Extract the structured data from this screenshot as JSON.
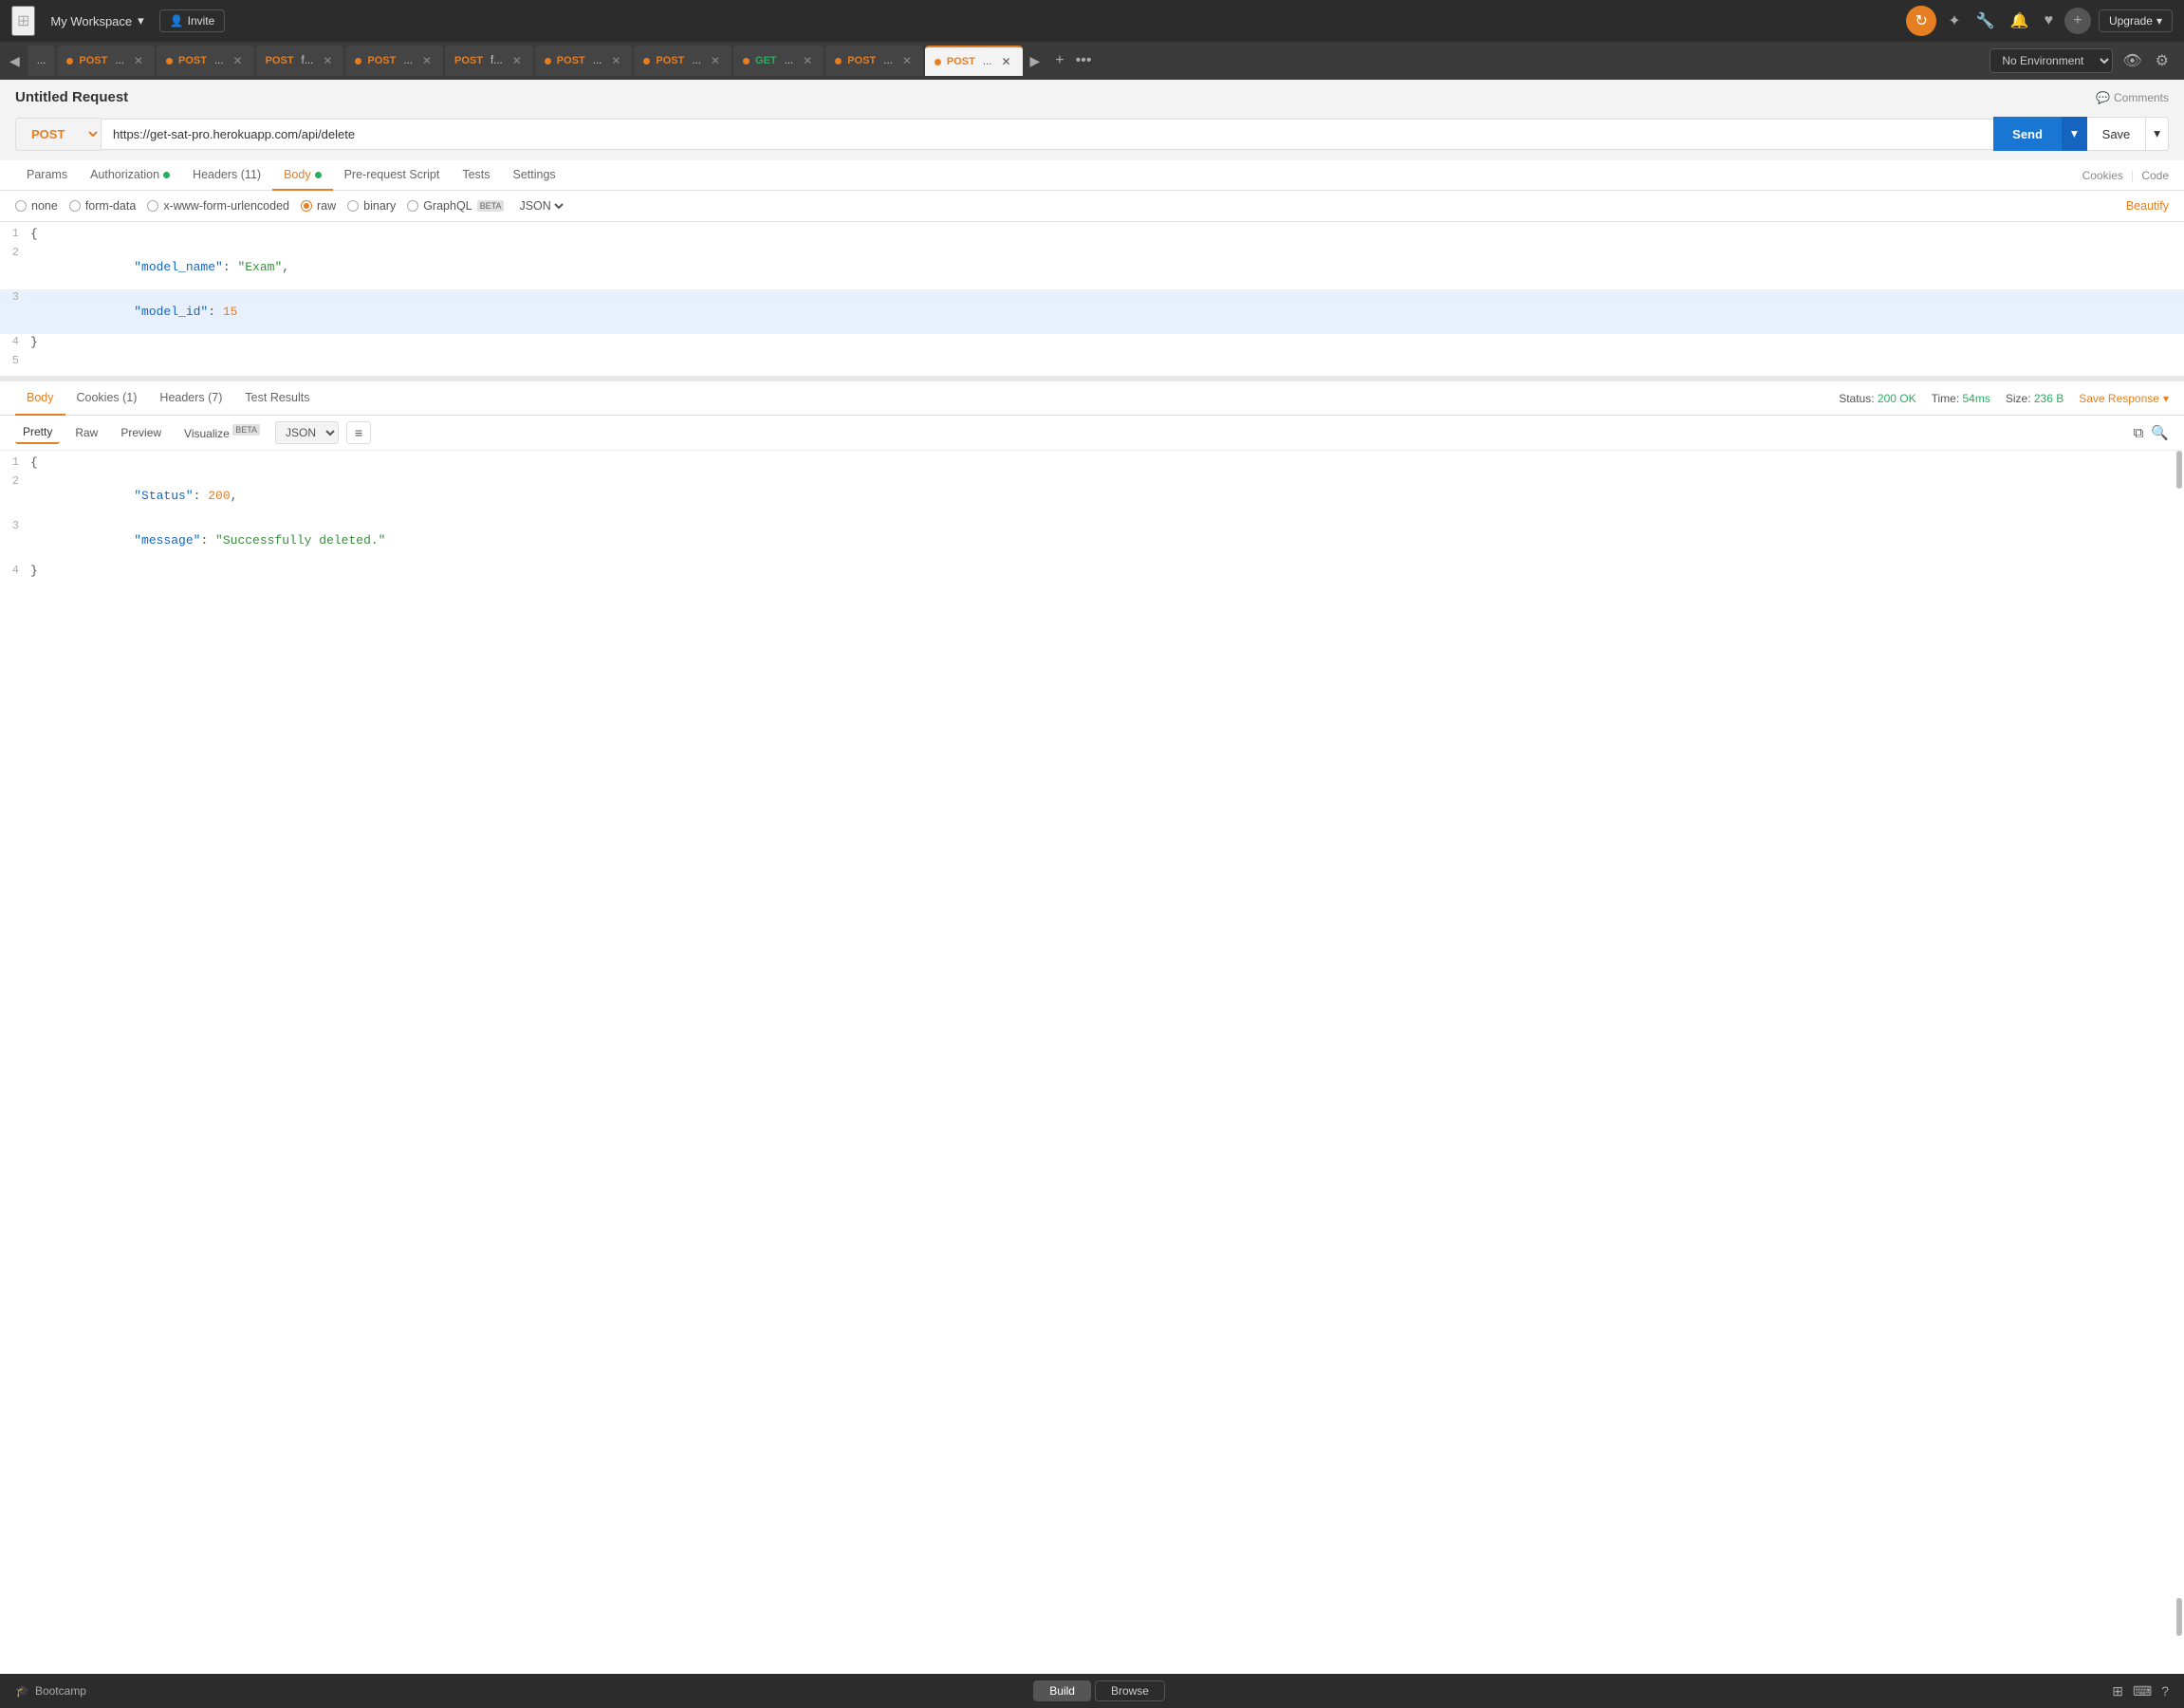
{
  "app": {
    "workspace_label": "My Workspace",
    "invite_label": "Invite"
  },
  "topnav": {
    "upgrade_label": "Upgrade"
  },
  "tabs": [
    {
      "id": "t0",
      "label": "...",
      "method": null,
      "dot": null,
      "active": false
    },
    {
      "id": "t1",
      "label": "POST ...",
      "method": "POST",
      "dot": "orange",
      "active": false
    },
    {
      "id": "t2",
      "label": "POST ...",
      "method": "POST",
      "dot": "orange",
      "active": false
    },
    {
      "id": "t3",
      "label": "POST f...",
      "method": "POST",
      "dot": null,
      "active": false
    },
    {
      "id": "t4",
      "label": "POST ...",
      "method": "POST",
      "dot": "orange",
      "active": false
    },
    {
      "id": "t5",
      "label": "POST f...",
      "method": "POST",
      "dot": null,
      "active": false
    },
    {
      "id": "t6",
      "label": "POST ...",
      "method": "POST",
      "dot": "orange",
      "active": false
    },
    {
      "id": "t7",
      "label": "POST ...",
      "method": "POST",
      "dot": "orange",
      "active": false
    },
    {
      "id": "t8",
      "label": "GET ...",
      "method": "GET",
      "dot": "orange",
      "active": false
    },
    {
      "id": "t9",
      "label": "POST ...",
      "method": "POST",
      "dot": "orange",
      "active": false
    },
    {
      "id": "t10",
      "label": "POST ...",
      "method": "POST",
      "dot": "orange",
      "active": true
    }
  ],
  "env": {
    "label": "No Environment",
    "options": [
      "No Environment"
    ]
  },
  "request": {
    "title": "Untitled Request",
    "comments_label": "Comments",
    "method": "POST",
    "url": "https://get-sat-pro.herokuapp.com/api/delete",
    "send_label": "Send",
    "save_label": "Save"
  },
  "req_tabs": {
    "items": [
      {
        "label": "Params",
        "active": false,
        "dot": false
      },
      {
        "label": "Authorization",
        "active": false,
        "dot": true,
        "dot_color": "green"
      },
      {
        "label": "Headers (11)",
        "active": false,
        "dot": false
      },
      {
        "label": "Body",
        "active": true,
        "dot": true,
        "dot_color": "green"
      },
      {
        "label": "Pre-request Script",
        "active": false,
        "dot": false
      },
      {
        "label": "Tests",
        "active": false,
        "dot": false
      },
      {
        "label": "Settings",
        "active": false,
        "dot": false
      }
    ],
    "cookies_label": "Cookies",
    "code_label": "Code"
  },
  "body_options": {
    "none_label": "none",
    "form_data_label": "form-data",
    "urlencoded_label": "x-www-form-urlencoded",
    "raw_label": "raw",
    "binary_label": "binary",
    "graphql_label": "GraphQL",
    "beta_label": "BETA",
    "json_label": "JSON",
    "beautify_label": "Beautify"
  },
  "request_body_lines": [
    {
      "num": "1",
      "content": "{",
      "type": "bracket"
    },
    {
      "num": "2",
      "content": "    \"model_name\": \"Exam\",",
      "type": "string_pair"
    },
    {
      "num": "3",
      "content": "    \"model_id\": 15",
      "type": "num_pair",
      "highlighted": true
    },
    {
      "num": "4",
      "content": "}",
      "type": "bracket"
    },
    {
      "num": "5",
      "content": "",
      "type": "empty"
    }
  ],
  "response": {
    "status_label": "Status:",
    "status_value": "200 OK",
    "time_label": "Time:",
    "time_value": "54ms",
    "size_label": "Size:",
    "size_value": "236 B",
    "save_response_label": "Save Response"
  },
  "resp_tabs": {
    "items": [
      {
        "label": "Body",
        "active": true,
        "dot": false,
        "count": null
      },
      {
        "label": "Cookies (1)",
        "active": false,
        "dot": false,
        "count": "1"
      },
      {
        "label": "Headers (7)",
        "active": false,
        "dot": false,
        "count": "7"
      },
      {
        "label": "Test Results",
        "active": false,
        "dot": false
      }
    ]
  },
  "resp_format": {
    "pretty_label": "Pretty",
    "raw_label": "Raw",
    "preview_label": "Preview",
    "visualize_label": "Visualize",
    "beta_label": "BETA",
    "json_label": "JSON"
  },
  "response_body_lines": [
    {
      "num": "1",
      "content": "{",
      "type": "bracket"
    },
    {
      "num": "2",
      "content": "    \"Status\": 200,",
      "type": "num_pair"
    },
    {
      "num": "3",
      "content": "    \"message\": \"Successfully deleted.\"",
      "type": "string_pair"
    },
    {
      "num": "4",
      "content": "}",
      "type": "bracket"
    }
  ],
  "bottom_bar": {
    "bootcamp_label": "Bootcamp",
    "build_label": "Build",
    "browse_label": "Browse"
  }
}
